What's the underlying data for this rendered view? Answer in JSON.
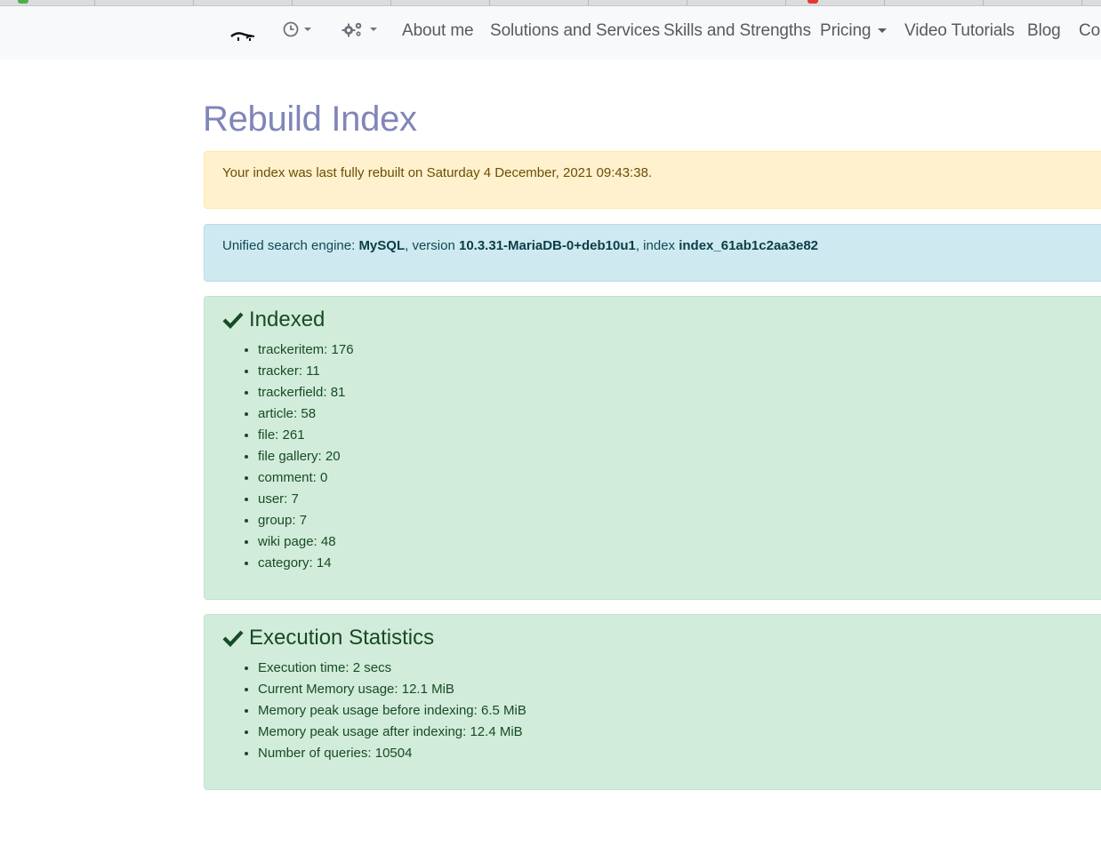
{
  "navbar": {
    "links": [
      {
        "label": "About me"
      },
      {
        "label": "Solutions and Services"
      },
      {
        "label": "Skills and Strengths"
      },
      {
        "label": "Pricing"
      },
      {
        "label": "Video Tutorials"
      },
      {
        "label": "Blog"
      },
      {
        "label": "Cor"
      }
    ],
    "icons": [
      "logo-icon",
      "clock-icon",
      "gears-icon"
    ]
  },
  "page": {
    "title": "Rebuild Index"
  },
  "warning": {
    "text": "Your index was last fully rebuilt on Saturday 4 December, 2021 09:43:38."
  },
  "info": {
    "prefix": "Unified search engine: ",
    "engine": "MySQL",
    "version_label": ", version ",
    "version": "10.3.31-MariaDB-0+deb10u1",
    "index_label": ", index ",
    "index": "index_61ab1c2aa3e82"
  },
  "indexed": {
    "heading": "Indexed",
    "items": [
      "trackeritem: 176",
      "tracker: 11",
      "trackerfield: 81",
      "article: 58",
      "file: 261",
      "file gallery: 20",
      "comment: 0",
      "user: 7",
      "group: 7",
      "wiki page: 48",
      "category: 14"
    ]
  },
  "stats": {
    "heading": "Execution Statistics",
    "items": [
      "Execution time: 2 secs",
      "Current Memory usage: 12.1 MiB",
      "Memory peak usage before indexing: 6.5 MiB",
      "Memory peak usage after indexing: 12.4 MiB",
      "Number of queries: 10504"
    ]
  },
  "colors": {
    "title": "#8086b8",
    "warning_bg": "#fff1cd",
    "info_bg": "#cfe9f0",
    "success_bg": "#d2ecdb",
    "success_text": "#174b24"
  }
}
